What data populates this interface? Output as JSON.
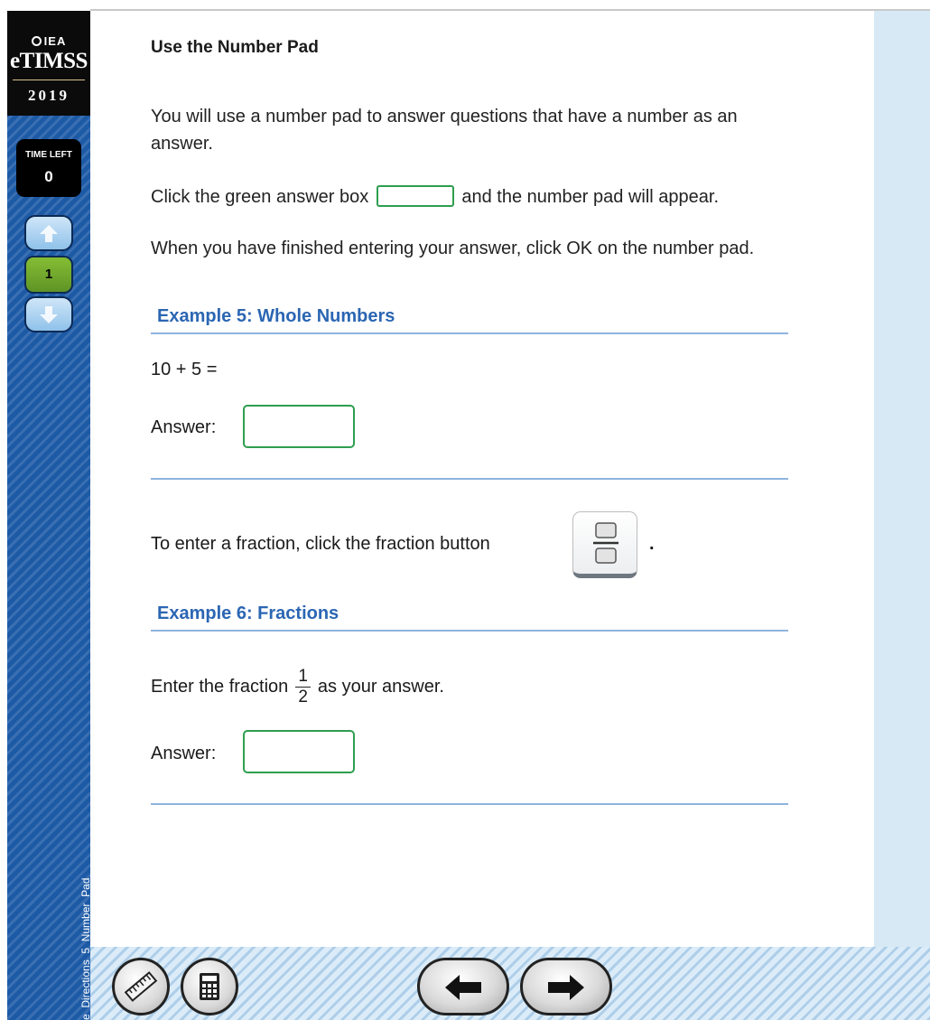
{
  "sidebar": {
    "logo_org": "IEA",
    "logo_name": "eTIMSS",
    "logo_year": "2019",
    "timer_label": "TIME LEFT",
    "timer_value": "0",
    "page_number": "1",
    "item_id": "e_Directions_5_Number_Pad",
    "icons": {
      "up": "arrow-up-icon",
      "down": "arrow-down-icon"
    }
  },
  "main": {
    "title": "Use the Number Pad",
    "p1": "You will use a number pad to answer questions that have a number as an answer.",
    "p2_before": "Click the green answer box",
    "p2_after": "and the number pad will appear.",
    "p3": "When you have finished entering your answer, click OK on the number pad.",
    "example5": {
      "heading": "Example 5: Whole Numbers",
      "equation": "10 + 5 =",
      "answer_label": "Answer:",
      "answer_value": ""
    },
    "fraction_instruction": "To enter a fraction, click the fraction button",
    "fraction_dot": ".",
    "example6": {
      "heading": "Example 6: Fractions",
      "before": "Enter the fraction",
      "numerator": "1",
      "denominator": "2",
      "after": "as your answer.",
      "answer_label": "Answer:",
      "answer_value": ""
    }
  },
  "toolbar": {
    "icons": {
      "ruler": "ruler-icon",
      "calculator": "calculator-icon",
      "back": "arrow-left-icon",
      "next": "arrow-right-icon"
    }
  },
  "colors": {
    "sidebar": "#1d5aa6",
    "answer_box_border": "#2e9e4f",
    "heading_blue": "#2b66b3",
    "rule_blue": "#8fb3de",
    "right_panel": "#d6e9f5"
  }
}
